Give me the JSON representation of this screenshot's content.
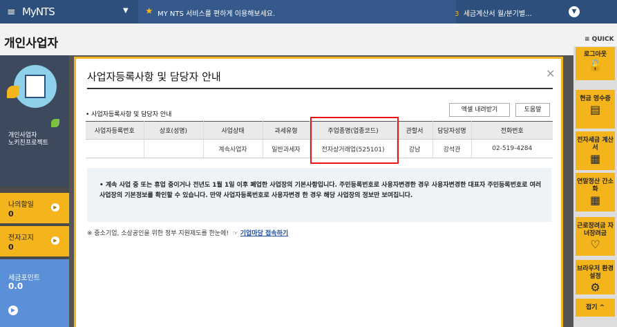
{
  "topbar": {
    "menu_icon": "hamburger-icon",
    "logo": "MyNTS",
    "notice": "MY NTS 서비스를 편하게 이용해보세요.",
    "alert_count": "3",
    "alert_text": "세금계산서 월/분기별..."
  },
  "page": {
    "title": "개인사업자",
    "quick_label": "≡ QUICK"
  },
  "profile": {
    "type": "개인사업자",
    "name": "노키친프로젝트"
  },
  "sidebar": {
    "my_payments_label": "나의할일",
    "my_payments_value": "0",
    "e_notice_label": "전자고지",
    "e_notice_value": "0",
    "points_label": "세금포인트",
    "points_value": "0.0"
  },
  "modal": {
    "title": "사업자등록사항 및 담당자 안내",
    "subtitle": "• 사업자등록사항 및 담당자 안내",
    "excel_button": "엑셀 내려받기",
    "help_button": "도움말",
    "table": {
      "headers": [
        "사업자등록번호",
        "상호(성명)",
        "사업상태",
        "과세유형",
        "주업종명(업종코드)",
        "관할서",
        "담당자성명",
        "전화번호"
      ],
      "rows": [
        [
          "",
          "",
          "계속사업자",
          "일반과세자",
          "전자상거래업(525101)",
          "강남",
          "강석관",
          "02-519-4284"
        ]
      ]
    },
    "info_text": "• 계속 사업 중 또는 휴업 중이거나 전년도 1월 1일 이후 폐업한 사업장의 기본사항입니다. 주민등록번호로 사용자변경한 경우 사용자변경한 대표자 주민등록번호로 여러 사업장의 기본정보를 확인할 수 있습니다. 만약 사업자등록번호로 사용자변경 한 경우 해당 사업장의 정보만 보여집니다.",
    "footer_text": "※ 중소기업, 소상공인을 위한 정부 지원제도를 한눈에!",
    "footer_link": "기업마당 접속하기"
  },
  "quick": {
    "items": [
      {
        "label": "로그아웃",
        "icon": "logout-icon"
      },
      {
        "label": "현금 영수증",
        "icon": "receipt-icon"
      },
      {
        "label": "전자세금 계산서",
        "icon": "invoice-icon"
      },
      {
        "label": "연말정산 간소화",
        "icon": "calculator-icon"
      },
      {
        "label": "근로장려금 자녀장려금",
        "icon": "heart-icon"
      },
      {
        "label": "브라우저 환경설정",
        "icon": "gear-icon"
      }
    ],
    "fold_label": "접기 ^"
  },
  "colors": {
    "accent": "#f3b51b",
    "nav": "#2d4f7c",
    "highlight": "#e11111"
  }
}
